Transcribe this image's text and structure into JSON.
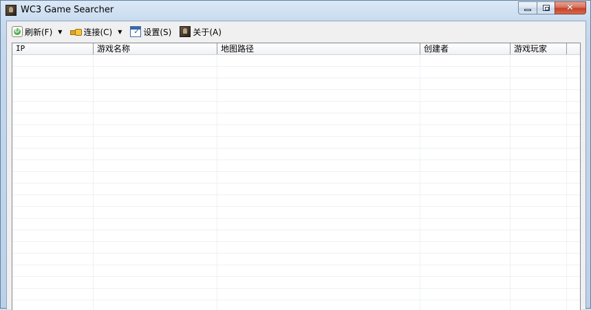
{
  "window": {
    "title": "WC3 Game Searcher",
    "icon": "warcraft-peasant-icon"
  },
  "caption_buttons": {
    "minimize": "minimize-icon",
    "maximize": "maximize-icon",
    "close_glyph": "✕"
  },
  "toolbar": {
    "refresh_label": "刷新(F)",
    "connect_label": "连接(C)",
    "settings_label": "设置(S)",
    "about_label": "关于(A)",
    "dropdown_glyph": "▼"
  },
  "list": {
    "columns": [
      "IP",
      "游戏名称",
      "地图路径",
      "创建者",
      "游戏玩家"
    ],
    "rows": []
  }
}
